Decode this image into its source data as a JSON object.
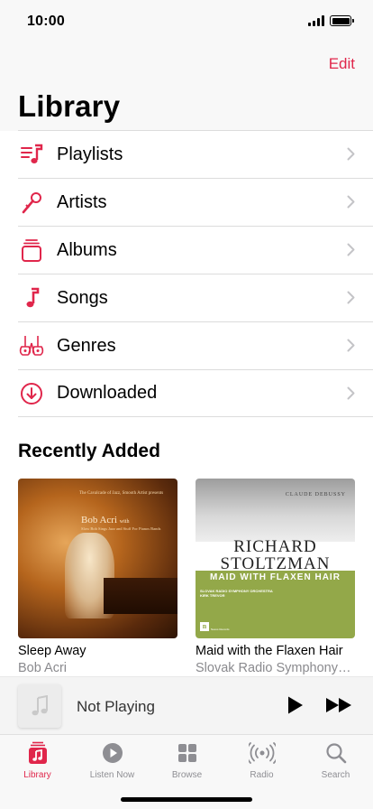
{
  "status_bar": {
    "time": "10:00"
  },
  "header": {
    "edit_label": "Edit",
    "title": "Library"
  },
  "menu": {
    "items": [
      {
        "label": "Playlists",
        "icon": "playlists-icon"
      },
      {
        "label": "Artists",
        "icon": "microphone-icon"
      },
      {
        "label": "Albums",
        "icon": "albums-icon"
      },
      {
        "label": "Songs",
        "icon": "music-note-icon"
      },
      {
        "label": "Genres",
        "icon": "genres-icon"
      },
      {
        "label": "Downloaded",
        "icon": "download-icon"
      }
    ]
  },
  "recently_added": {
    "title": "Recently Added",
    "albums": [
      {
        "title": "Sleep Away",
        "artist": "Bob Acri",
        "cover_text": {
          "top": "The Cavalcade of Jazz, Smooth Artist presents",
          "name": "Bob Acri",
          "name_suffix": "with",
          "sub": "Slow Bob Sings Jazz and Stuff For Pianos Bands"
        }
      },
      {
        "title": "Maid with the Flaxen Hair",
        "artist": "Slovak Radio Symphony…",
        "cover_text": {
          "composer": "CLAUDE DEBUSSY",
          "line1": "RICHARD",
          "line2": "STOLTZMAN",
          "sub": "MAID WITH FLAXEN HAIR",
          "orch1": "SLOVAK RADIO SYMPHONY ORCHESTRA",
          "orch2": "KIRK TREVOR",
          "logo": "n",
          "label": "Naxos Records"
        }
      }
    ]
  },
  "mini_player": {
    "title": "Not Playing"
  },
  "tab_bar": {
    "tabs": [
      {
        "label": "Library",
        "active": true
      },
      {
        "label": "Listen Now",
        "active": false
      },
      {
        "label": "Browse",
        "active": false
      },
      {
        "label": "Radio",
        "active": false
      },
      {
        "label": "Search",
        "active": false
      }
    ]
  },
  "colors": {
    "accent": "#e0264b",
    "secondary_text": "#8a8a8e",
    "separator": "#dcdcdc"
  }
}
